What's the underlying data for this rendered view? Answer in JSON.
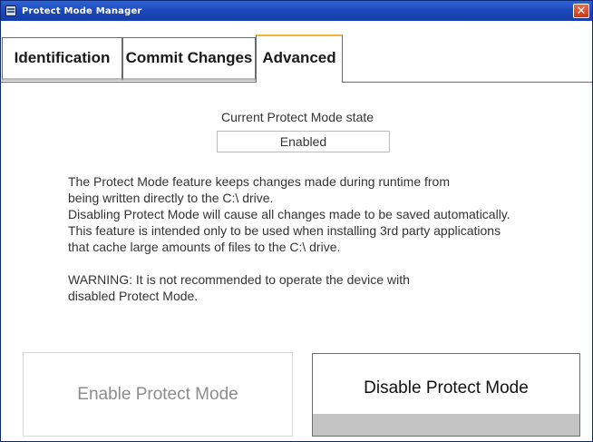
{
  "window": {
    "title": "Protect Mode Manager",
    "app_icon": "window-icon",
    "close_symbol": "✕"
  },
  "tabs": [
    {
      "label": "Identification",
      "active": false
    },
    {
      "label": "Commit Changes",
      "active": false
    },
    {
      "label": "Advanced",
      "active": true
    }
  ],
  "state": {
    "label": "Current Protect Mode state",
    "value": "Enabled"
  },
  "description": {
    "lines": [
      "The Protect Mode feature keeps changes made during runtime from",
      "being written directly to the C:\\ drive.",
      "Disabling Protect Mode will cause all changes made to be saved automatically.",
      "This feature is intended only to be used when installing 3rd party applications",
      "that cache large amounts of files to the C:\\ drive."
    ],
    "warning_lines": [
      "WARNING: It is not recommended to operate the device with",
      "disabled Protect Mode."
    ]
  },
  "buttons": {
    "enable": {
      "label": "Enable Protect Mode",
      "enabled": false
    },
    "disable": {
      "label": "Disable Protect Mode",
      "enabled": true
    }
  }
}
